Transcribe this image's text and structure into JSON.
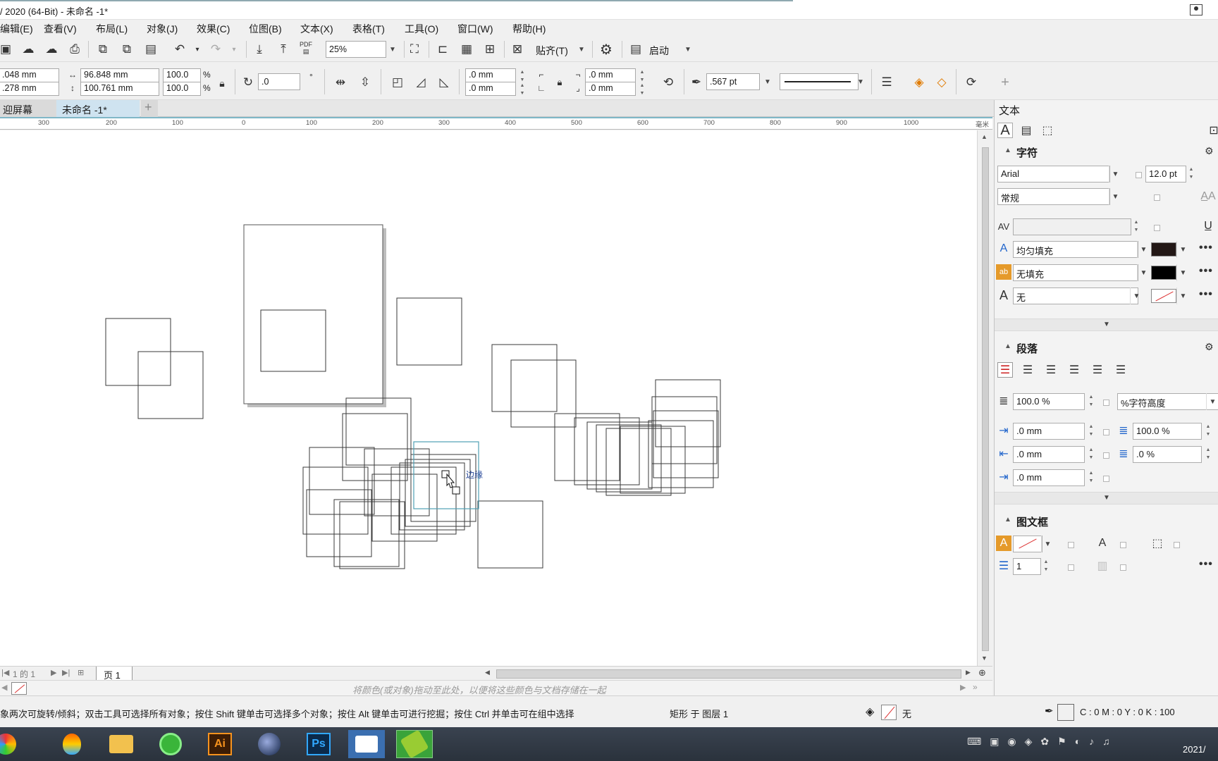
{
  "window": {
    "title": "/ 2020 (64-Bit) - 未命名 -1*"
  },
  "menubar": {
    "items": [
      "编辑(E)",
      "查看(V)",
      "布局(L)",
      "对象(J)",
      "效果(C)",
      "位图(B)",
      "文本(X)",
      "表格(T)",
      "工具(O)",
      "窗口(W)",
      "帮助(H)"
    ]
  },
  "toolbar1": {
    "zoom": "25%",
    "snap_label": "贴齐(T)",
    "launch_label": "启动",
    "pdf_label": "PDF"
  },
  "toolbar2": {
    "pos_x": ".048 mm",
    "pos_y": ".278 mm",
    "width": "96.848 mm",
    "height": "100.761 mm",
    "scale_x": "100.0",
    "scale_y": "100.0",
    "percent": "%",
    "rotation": ".0",
    "degree": "°",
    "corner_1": ".0 mm",
    "corner_2": ".0 mm",
    "corner_3": ".0 mm",
    "corner_4": ".0 mm",
    "outline_width": ".567 pt"
  },
  "tabs": {
    "welcome": "迎屏幕",
    "document": "未命名 -1*",
    "add": "+"
  },
  "ruler": {
    "ticks": [
      "300",
      "200",
      "100",
      "0",
      "100",
      "200",
      "300",
      "400",
      "500",
      "600",
      "700",
      "800",
      "900",
      "1000",
      "毫米"
    ]
  },
  "canvas": {
    "tooltip": "边缘"
  },
  "pagebar": {
    "page_of": "1 的 1",
    "page_tab": "页 1"
  },
  "palette": {
    "hint": "将颜色(或对象)拖动至此处，以便将这些颜色与文档存储在一起"
  },
  "statusbar": {
    "hint": "象两次可旋转/倾斜；双击工具可选择所有对象；按住 Shift 键单击可选择多个对象；按住 Alt 键单击可进行挖掘；按住 Ctrl 并单击可在组中选择",
    "object_info": "矩形 于 图层 1",
    "fill_label": "无",
    "color_info": "C : 0 M : 0 Y : 0 K : 100"
  },
  "docker": {
    "title": "文本",
    "character": {
      "heading": "字符",
      "font": "Arial",
      "size": "12.0 pt",
      "style": "常规",
      "fill_type": "均匀填充",
      "bg_fill": "无填充",
      "outline": "无"
    },
    "paragraph": {
      "heading": "段落",
      "line_spacing": "100.0 %",
      "spacing_unit": "%字符高度",
      "indent_first": ".0 mm",
      "indent_left": ".0 mm",
      "indent_right": ".0 mm",
      "char_spacing": "100.0 %",
      "word_spacing": ".0 %"
    },
    "frame": {
      "heading": "图文框",
      "columns": "1"
    }
  },
  "taskbar": {
    "apps": [
      "Ai",
      "Ps"
    ],
    "clock": "2021/"
  },
  "colors": {
    "fill_swatch": "#231816",
    "outline_swatch": "#000000",
    "selection": "#4fa0b4",
    "tab_active": "#cfe3f0"
  }
}
